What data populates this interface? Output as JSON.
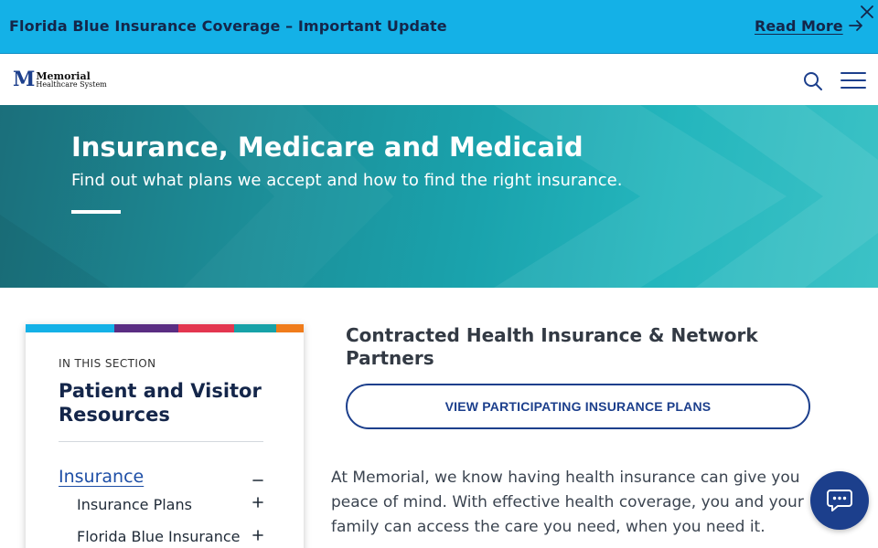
{
  "alert": {
    "text": "Florida Blue Insurance Coverage – Important Update",
    "link_label": "Read More",
    "arrow_icon": "arrow-right-icon",
    "close_icon": "close-icon"
  },
  "header": {
    "logo": {
      "mark": "M",
      "line1": "Memorial",
      "line2": "Healthcare System"
    },
    "search_icon": "search-icon",
    "menu_icon": "hamburger-menu-icon"
  },
  "hero": {
    "title": "Insurance, Medicare and Medicaid",
    "subtitle": "Find out what plans we accept and how to find the right insurance."
  },
  "sidebar": {
    "stripe_colors": [
      "#14b1e7",
      "#5a2d82",
      "#e3364f",
      "#17a2a8",
      "#f07c1b"
    ],
    "eyebrow": "IN THIS SECTION",
    "title": "Patient and Visitor Resources",
    "primary": {
      "label": "Insurance",
      "toggle": "minus-icon"
    },
    "items": [
      {
        "label": "Insurance Plans",
        "toggle": "plus-icon"
      },
      {
        "label": "Florida Blue Insurance",
        "toggle": "plus-icon"
      }
    ]
  },
  "main": {
    "heading": "Contracted Health Insurance & Network Partners",
    "cta_label": "VIEW PARTICIPATING INSURANCE PLANS",
    "body": "At Memorial, we know having health insurance can give you peace of mind. With effective health coverage, you and your family can access the care you need, when you need it."
  },
  "chat": {
    "icon": "chat-icon"
  },
  "colors": {
    "alert_bg": "#14b1e7",
    "navy": "#1c3f8c",
    "link_blue": "#1d4ea6",
    "hero_teal": "#1aa3ad"
  }
}
